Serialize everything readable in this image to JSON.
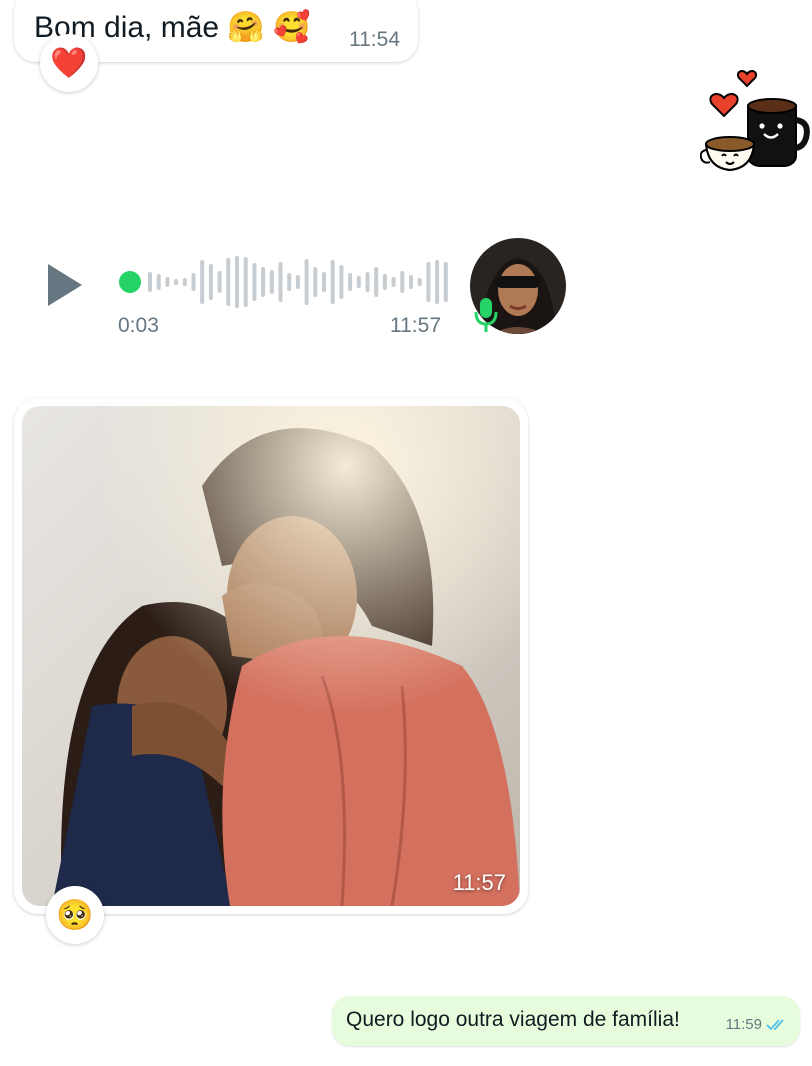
{
  "messages": {
    "greeting": {
      "text": "Bom dia, mãe 🤗 🥰",
      "time": "11:54",
      "reaction": "❤️"
    },
    "voice": {
      "duration": "0:03",
      "time": "11:57",
      "icon_play": "play-icon",
      "icon_mic": "mic-icon",
      "accent": "#25d366"
    },
    "photo": {
      "time": "11:57",
      "reaction": "🥺"
    },
    "outgoing": {
      "text": "Quero logo outra viagem de família!",
      "time": "11:59",
      "status_icon": "double-check-icon",
      "status_color": "#53bdeb"
    }
  },
  "colors": {
    "outgoing_bubble": "#e7fcdc",
    "incoming_bubble": "#ffffff",
    "meta_text": "#667781"
  }
}
